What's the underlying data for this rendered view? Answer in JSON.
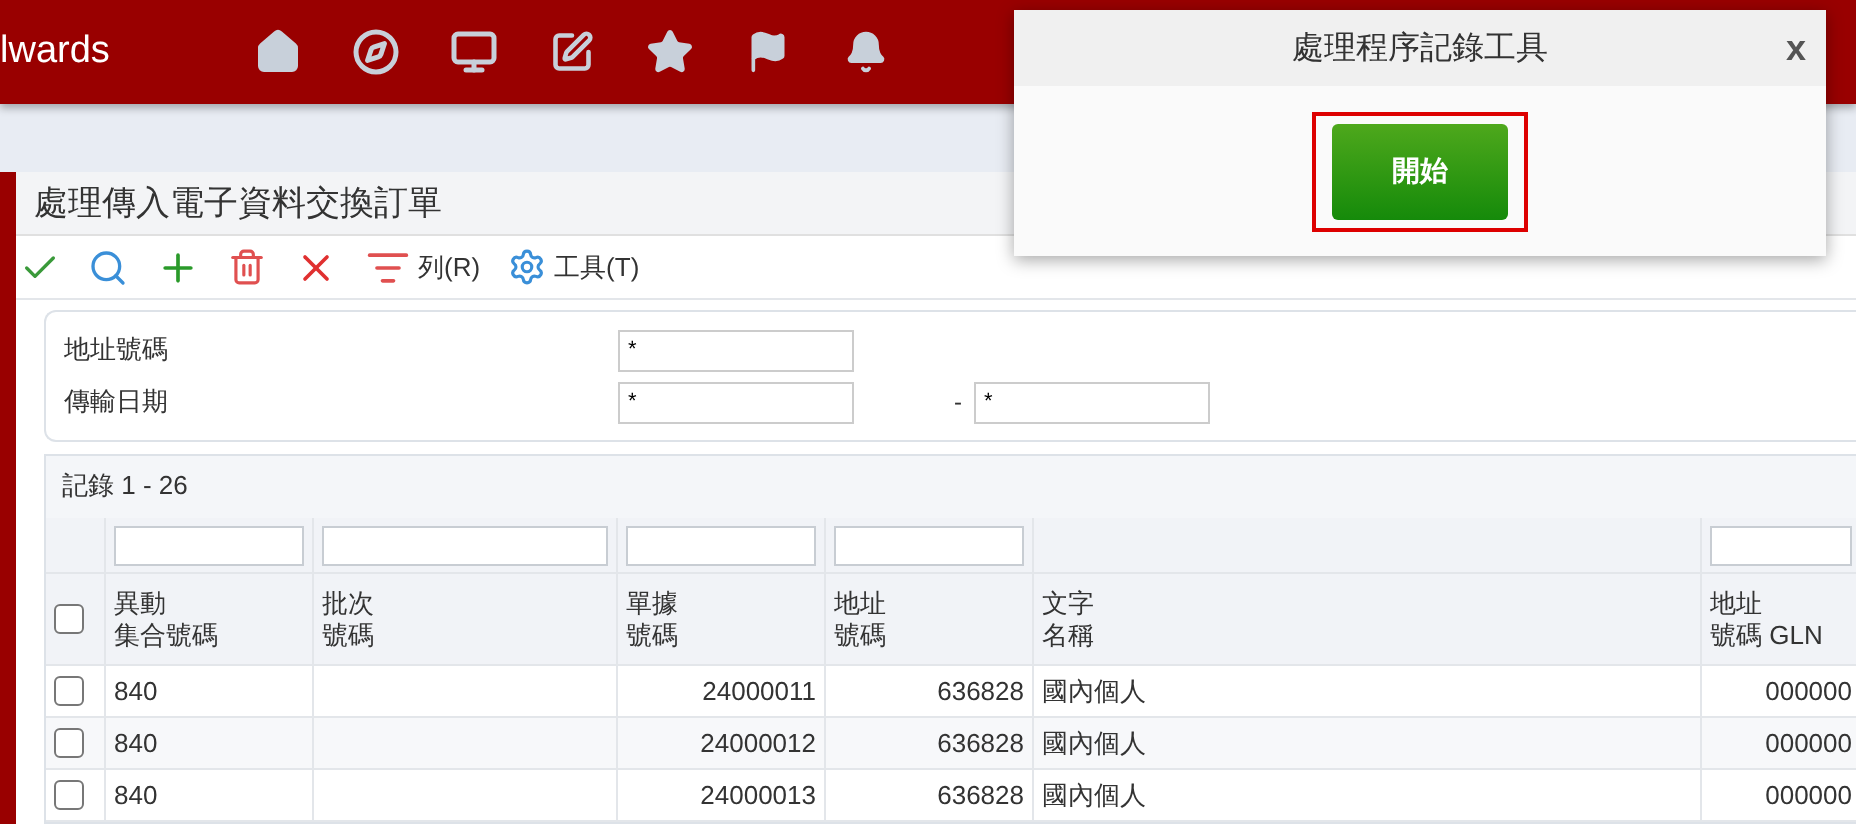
{
  "app_bar": {
    "brand": "lwards",
    "icons": [
      {
        "kind": "home"
      },
      {
        "kind": "compass"
      },
      {
        "kind": "monitor"
      },
      {
        "kind": "edit"
      },
      {
        "kind": "star"
      },
      {
        "kind": "flag"
      },
      {
        "kind": "bell"
      }
    ]
  },
  "page": {
    "title": "處理傳入電子資料交換訂單",
    "toolbar": [
      {
        "kind": "check"
      },
      {
        "kind": "search"
      },
      {
        "kind": "add"
      },
      {
        "kind": "trash"
      },
      {
        "kind": "close"
      },
      {
        "kind": "rows",
        "label": "列(R)"
      },
      {
        "kind": "gear",
        "label": "工具(T)"
      }
    ],
    "form": [
      {
        "label": "地址號碼",
        "value": "*"
      },
      {
        "label": "傳輸日期",
        "value": "*",
        "separator": "-",
        "value_to": "*"
      }
    ],
    "grid": {
      "record_count": "記錄 1 - 26",
      "header_checked": false,
      "columns": [
        {
          "lines": [
            "異動",
            "集合號碼"
          ],
          "filter": true,
          "kind": "text"
        },
        {
          "lines": [
            "批次",
            "號碼"
          ],
          "filter": true,
          "kind": "text"
        },
        {
          "lines": [
            "單據",
            "號碼"
          ],
          "filter": true,
          "kind": "number"
        },
        {
          "lines": [
            "地址",
            "號碼"
          ],
          "filter": true,
          "kind": "number"
        },
        {
          "lines": [
            "文字",
            "名稱"
          ],
          "filter": false,
          "kind": "text"
        },
        {
          "lines": [
            "地址",
            "號碼 GLN"
          ],
          "filter": true,
          "kind": "number"
        }
      ],
      "rows": [
        {
          "checked": false,
          "cells": [
            "840",
            "",
            "24000011",
            "636828",
            "國內個人",
            "000000"
          ]
        },
        {
          "checked": false,
          "cells": [
            "840",
            "",
            "24000012",
            "636828",
            "國內個人",
            "000000"
          ]
        },
        {
          "checked": false,
          "cells": [
            "840",
            "",
            "24000013",
            "636828",
            "國內個人",
            "000000"
          ]
        }
      ]
    }
  },
  "dialog": {
    "title": "處理程序記錄工具",
    "close": "x",
    "button": "開始",
    "button_highlighted": true
  }
}
